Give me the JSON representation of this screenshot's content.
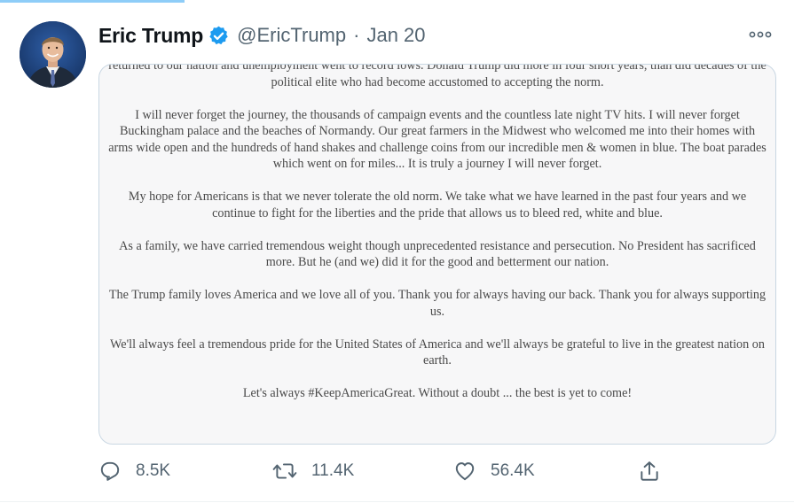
{
  "tweet": {
    "display_name": "Eric Trump",
    "handle": "@EricTrump",
    "separator": "·",
    "date": "Jan 20",
    "verified": true,
    "accent_color": "#1d9bf0"
  },
  "media": {
    "paragraphs": [
      "returned to our nation and unemployment went to record lows. Donald Trump did more in four short years, than did decades of the political elite who had become accustomed to accepting the norm.",
      "I will never forget the journey, the thousands of campaign events and the countless late night TV hits. I will never forget Buckingham palace and the beaches of Normandy. Our great farmers in the Midwest who welcomed me into their homes with arms wide open and the hundreds of hand shakes and challenge coins from our incredible men & women in blue. The boat parades which went on for miles... It is truly a journey I will never forget.",
      "My hope for Americans is that we never tolerate the old norm. We take what we have learned in the past four years and we continue to fight for the liberties and the pride that allows us to bleed red, white and blue.",
      "As a family, we have carried tremendous weight though unprecedented resistance and persecution. No President has sacrificed more. But he (and we) did it for the good and betterment our nation.",
      "The Trump family loves America and we love all of you. Thank you for always having our back. Thank you for always supporting us.",
      "We'll always feel a tremendous pride for the United States of America and we'll always be grateful to live in the greatest nation on earth.",
      "Let's always #KeepAmericaGreat. Without a doubt ... the best is yet to come!"
    ]
  },
  "actions": {
    "reply_icon": "reply-icon",
    "reply_count": "8.5K",
    "retweet_icon": "retweet-icon",
    "retweet_count": "11.4K",
    "like_icon": "like-icon",
    "like_count": "56.4K",
    "share_icon": "share-icon"
  }
}
